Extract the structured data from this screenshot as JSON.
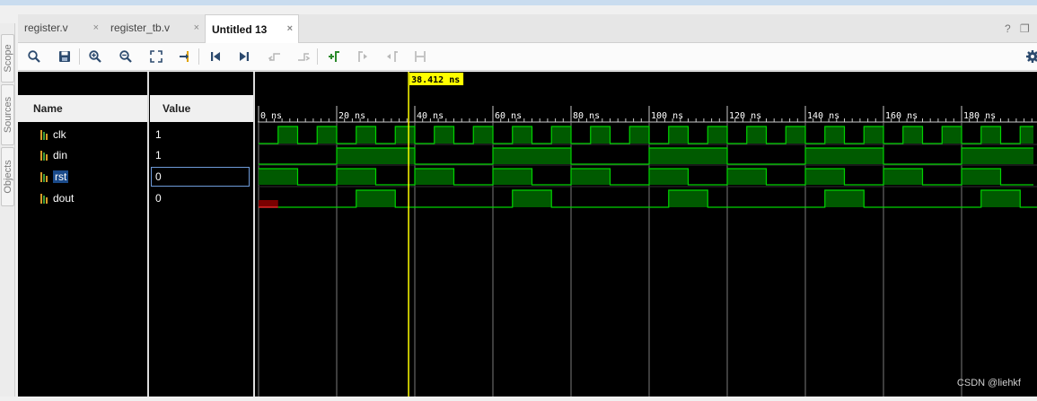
{
  "tabs": [
    {
      "label": "register.v",
      "close": "×",
      "active": false
    },
    {
      "label": "register_tb.v",
      "close": "×",
      "active": false
    },
    {
      "label": "Untitled 13",
      "close": "×",
      "active": true
    }
  ],
  "window_controls": {
    "help": "?",
    "restore": "❐"
  },
  "side_tabs": [
    "Scope",
    "Sources",
    "Objects"
  ],
  "toolbar": {
    "icons": [
      "search-icon",
      "save-icon",
      "zoom-in-icon",
      "zoom-out-icon",
      "zoom-fit-icon",
      "go-to-cursor-icon",
      "go-to-start-icon",
      "go-to-end-icon",
      "prev-transition-icon",
      "next-transition-icon",
      "add-marker-icon",
      "prev-marker-icon",
      "next-marker-icon",
      "swap-cursors-icon"
    ],
    "settings_icon": "gear-icon"
  },
  "columns": {
    "name": "Name",
    "value": "Value"
  },
  "signals": [
    {
      "name": "clk",
      "value": "1",
      "selected": false
    },
    {
      "name": "din",
      "value": "1",
      "selected": false
    },
    {
      "name": "rst",
      "value": "0",
      "selected": true
    },
    {
      "name": "dout",
      "value": "0",
      "selected": false
    }
  ],
  "cursor": {
    "label": "38.412 ns",
    "time_ns": 38.412
  },
  "time_axis": {
    "start_ns": 0,
    "end_ns": 198.4,
    "major_ticks": [
      "0 ns",
      "20 ns",
      "40 ns",
      "60 ns",
      "80 ns",
      "100 ns",
      "120 ns",
      "140 ns",
      "160 ns",
      "180 ns"
    ],
    "major_step_ns": 20,
    "minor_step_ns": 2
  },
  "waveforms": {
    "clk": {
      "initial": 0,
      "transitions_ns": [
        5,
        10,
        15,
        20,
        25,
        30,
        35,
        40,
        45,
        50,
        55,
        60,
        65,
        70,
        75,
        80,
        85,
        90,
        95,
        100,
        105,
        110,
        115,
        120,
        125,
        130,
        135,
        140,
        145,
        150,
        155,
        160,
        165,
        170,
        175,
        180,
        185,
        190,
        195
      ]
    },
    "din": {
      "initial": 0,
      "transitions_ns": [
        20,
        40,
        60,
        80,
        100,
        120,
        140,
        160,
        180
      ]
    },
    "rst": {
      "initial": 1,
      "transitions_ns": [
        10,
        20,
        30,
        40,
        50,
        60,
        70,
        80,
        90,
        100,
        110,
        120,
        130,
        140,
        150,
        160,
        170,
        180,
        190
      ]
    },
    "dout": {
      "initial": "X",
      "undefined_until_ns": 5,
      "high_intervals_ns": [
        [
          25,
          35
        ],
        [
          65,
          75
        ],
        [
          105,
          115
        ],
        [
          145,
          155
        ],
        [
          185,
          195
        ]
      ]
    }
  },
  "colors": {
    "wave": "#00d200",
    "fill": "#005a00",
    "grid": "#7a7a7a",
    "cursor": "#ffff00",
    "undefined": "#7a0000"
  },
  "watermark": "CSDN @liehkf"
}
